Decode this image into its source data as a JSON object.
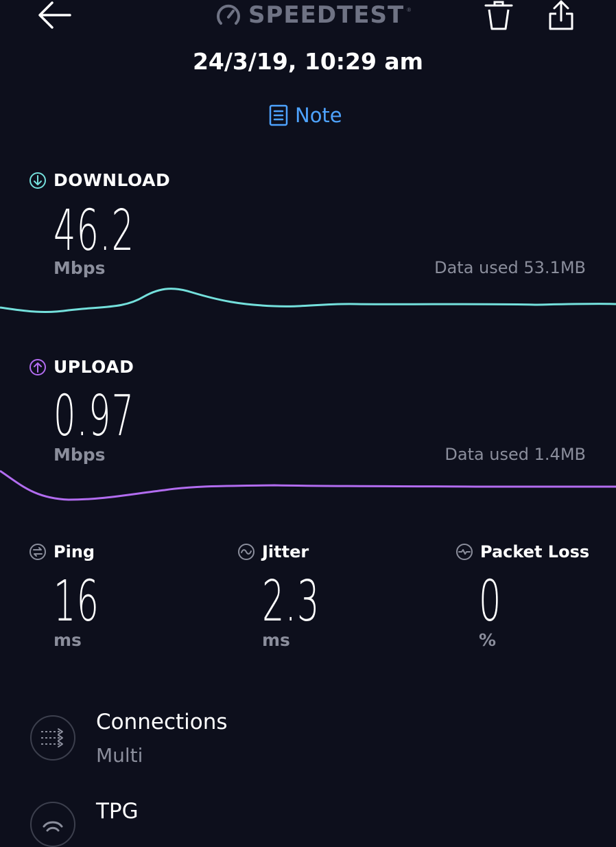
{
  "header": {
    "brand": "SPEEDTEST",
    "brand_mark": "®",
    "back_icon": "arrow-left-icon",
    "trash_icon": "trash-icon",
    "share_icon": "share-icon"
  },
  "result": {
    "datetime": "24/3/19, 10:29 am",
    "note_label": "Note"
  },
  "download": {
    "title": "DOWNLOAD",
    "value": "46.2",
    "unit": "Mbps",
    "data_used": "Data used 53.1MB",
    "color": "#74e0dc"
  },
  "upload": {
    "title": "UPLOAD",
    "value": "0.97",
    "unit": "Mbps",
    "data_used": "Data used 1.4MB",
    "color": "#b26cf0"
  },
  "stats": {
    "ping": {
      "title": "Ping",
      "value": "16",
      "unit": "ms"
    },
    "jitter": {
      "title": "Jitter",
      "value": "2.3",
      "unit": "ms"
    },
    "packet_loss": {
      "title": "Packet Loss",
      "value": "0",
      "unit": "%"
    }
  },
  "info": {
    "connections": {
      "title": "Connections",
      "value": "Multi"
    },
    "provider": {
      "title": "TPG"
    }
  }
}
